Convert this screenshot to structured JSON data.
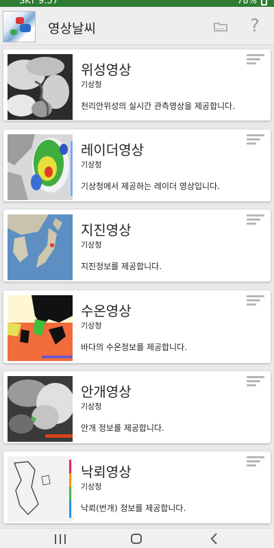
{
  "status_bar": {
    "time": "SKT 9:57",
    "battery": "78%"
  },
  "app": {
    "title": "영상날씨",
    "folder_icon": "folder-icon",
    "help_icon": "help-icon",
    "help_glyph": "?"
  },
  "cards": [
    {
      "title": "위성영상",
      "agency": "기상청",
      "description": "천리안위성의 실시간 관측영상을 제공합니다.",
      "thumb_icon": "satellite-image-icon"
    },
    {
      "title": "레이더영상",
      "agency": "기상청",
      "description": "기상청에서 제공하는 레이더 영상입니다.",
      "thumb_icon": "radar-image-icon"
    },
    {
      "title": "지진영상",
      "agency": "기상청",
      "description": "지진정보를 제공합니다.",
      "thumb_icon": "earthquake-map-icon"
    },
    {
      "title": "수온영상",
      "agency": "기상청",
      "description": "바다의 수온정보를 제공합니다.",
      "thumb_icon": "sea-temperature-map-icon"
    },
    {
      "title": "안개영상",
      "agency": "기상청",
      "description": "안개 정보를 제공합니다.",
      "thumb_icon": "fog-image-icon"
    },
    {
      "title": "낙뢰영상",
      "agency": "기상청",
      "description": "낙뢰(번개) 정보를 제공합니다.",
      "thumb_icon": "lightning-map-icon"
    }
  ],
  "colors": {
    "status_bar": "#2e7d32",
    "app_bar": "#eeeeee",
    "background": "#e9e9e9",
    "card": "#ffffff",
    "menu_icon": "#b5b5b5"
  }
}
